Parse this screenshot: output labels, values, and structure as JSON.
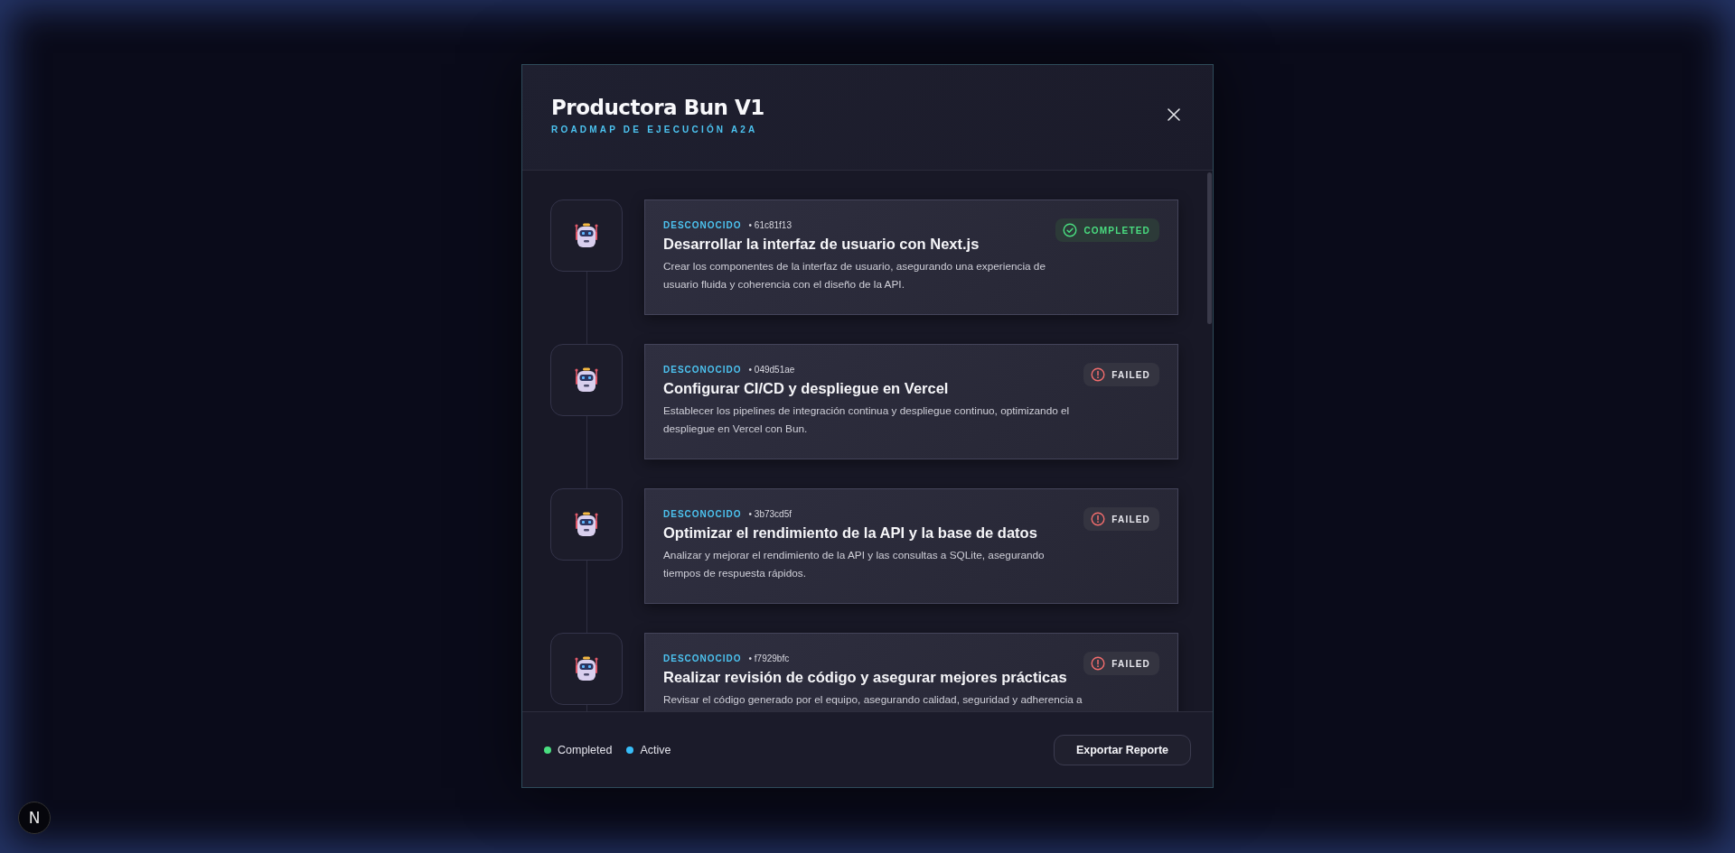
{
  "modal": {
    "title": "Productora Bun V1",
    "subtitle": "ROADMAP DE EJECUCIÓN A2A"
  },
  "tasks": [
    {
      "agent": "DESCONOCIDO",
      "id": "• 61c81f13",
      "title": "Desarrollar la interfaz de usuario con Next.js",
      "description": "Crear los componentes de la interfaz de usuario, asegurando una experiencia de usuario fluida y coherencia con el diseño de la API.",
      "kind": "completed",
      "status_label": "COMPLETED"
    },
    {
      "agent": "DESCONOCIDO",
      "id": "• 049d51ae",
      "title": "Configurar CI/CD y despliegue en Vercel",
      "description": "Establecer los pipelines de integración continua y despliegue continuo, optimizando el despliegue en Vercel con Bun.",
      "kind": "failed",
      "status_label": "FAILED"
    },
    {
      "agent": "DESCONOCIDO",
      "id": "• 3b73cd5f",
      "title": "Optimizar el rendimiento de la API y la base de datos",
      "description": "Analizar y mejorar el rendimiento de la API y las consultas a SQLite, asegurando tiempos de respuesta rápidos.",
      "kind": "failed",
      "status_label": "FAILED"
    },
    {
      "agent": "DESCONOCIDO",
      "id": "• f7929bfc",
      "title": "Realizar revisión de código y asegurar mejores prácticas",
      "description": "Revisar el código generado por el equipo, asegurando calidad, seguridad y adherencia a",
      "kind": "failed",
      "status_label": "FAILED"
    }
  ],
  "legend": [
    {
      "label": "Completed",
      "color": "#4ade80"
    },
    {
      "label": "Active",
      "color": "#38bdf8"
    }
  ],
  "export_button": "Exportar Reporte",
  "corner_badge": "N"
}
